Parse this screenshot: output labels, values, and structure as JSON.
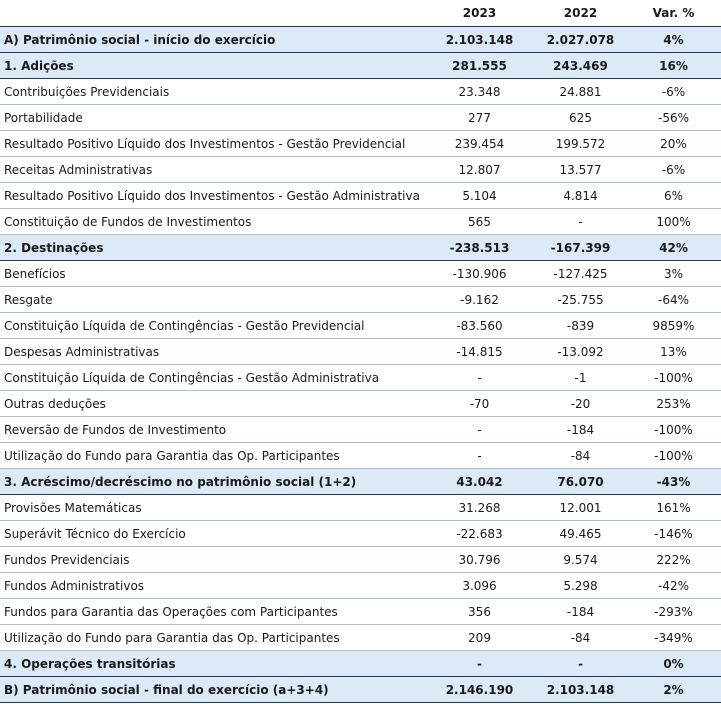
{
  "header": {
    "label": "",
    "y2023": "2023",
    "y2022": "2022",
    "var": "Var. %"
  },
  "rows": [
    {
      "label": "A) Patrimônio social - início do exercício",
      "y2023": "2.103.148",
      "y2022": "2.027.078",
      "var": "4%",
      "highlight": true
    },
    {
      "label": "1. Adições",
      "y2023": "281.555",
      "y2022": "243.469",
      "var": "16%",
      "highlight": true
    },
    {
      "label": "Contribuições Previdenciais",
      "y2023": "23.348",
      "y2022": "24.881",
      "var": "-6%",
      "highlight": false
    },
    {
      "label": "Portabilidade",
      "y2023": "277",
      "y2022": "625",
      "var": "-56%",
      "highlight": false
    },
    {
      "label": "Resultado Positivo Líquido dos Investimentos - Gestão Previdencial",
      "y2023": "239.454",
      "y2022": "199.572",
      "var": "20%",
      "highlight": false
    },
    {
      "label": "Receitas Administrativas",
      "y2023": "12.807",
      "y2022": "13.577",
      "var": "-6%",
      "highlight": false
    },
    {
      "label": "Resultado Positivo Líquido dos Investimentos - Gestão Administrativa",
      "y2023": "5.104",
      "y2022": "4.814",
      "var": "6%",
      "highlight": false
    },
    {
      "label": "Constituição de Fundos de Investimentos",
      "y2023": "565",
      "y2022": "-",
      "var": "100%",
      "highlight": false
    },
    {
      "label": "2. Destinações",
      "y2023": "-238.513",
      "y2022": "-167.399",
      "var": "42%",
      "highlight": true
    },
    {
      "label": "Benefícios",
      "y2023": "-130.906",
      "y2022": "-127.425",
      "var": "3%",
      "highlight": false
    },
    {
      "label": "Resgate",
      "y2023": "-9.162",
      "y2022": "-25.755",
      "var": "-64%",
      "highlight": false
    },
    {
      "label": "Constituição Líquida de Contingências - Gestão Previdencial",
      "y2023": "-83.560",
      "y2022": "-839",
      "var": "9859%",
      "highlight": false
    },
    {
      "label": "Despesas Administrativas",
      "y2023": "-14.815",
      "y2022": "-13.092",
      "var": "13%",
      "highlight": false
    },
    {
      "label": "Constituição Líquida de Contingências - Gestão Administrativa",
      "y2023": "-",
      "y2022": "-1",
      "var": "-100%",
      "highlight": false
    },
    {
      "label": "Outras deduções",
      "y2023": "-70",
      "y2022": "-20",
      "var": "253%",
      "highlight": false
    },
    {
      "label": "Reversão de Fundos de Investimento",
      "y2023": "-",
      "y2022": "-184",
      "var": "-100%",
      "highlight": false
    },
    {
      "label": "Utilização do Fundo para Garantia das Op. Participantes",
      "y2023": "-",
      "y2022": "-84",
      "var": "-100%",
      "highlight": false
    },
    {
      "label": "3. Acréscimo/decréscimo no patrimônio social (1+2)",
      "y2023": "43.042",
      "y2022": "76.070",
      "var": "-43%",
      "highlight": true
    },
    {
      "label": "Provisões Matemáticas",
      "y2023": "31.268",
      "y2022": "12.001",
      "var": "161%",
      "highlight": false
    },
    {
      "label": "Superávit Técnico do Exercício",
      "y2023": "-22.683",
      "y2022": "49.465",
      "var": "-146%",
      "highlight": false
    },
    {
      "label": "Fundos Previdenciais",
      "y2023": "30.796",
      "y2022": "9.574",
      "var": "222%",
      "highlight": false
    },
    {
      "label": "Fundos Administrativos",
      "y2023": "3.096",
      "y2022": "5.298",
      "var": "-42%",
      "highlight": false
    },
    {
      "label": "Fundos para Garantia das Operações com Participantes",
      "y2023": "356",
      "y2022": "-184",
      "var": "-293%",
      "highlight": false
    },
    {
      "label": "Utilização do Fundo para Garantia das Op. Participantes",
      "y2023": "209",
      "y2022": "-84",
      "var": "-349%",
      "highlight": false
    },
    {
      "label": "4. Operações transitórias",
      "y2023": "-",
      "y2022": "-",
      "var": "0%",
      "highlight": true
    },
    {
      "label": "B) Patrimônio social - final do exercício (a+3+4)",
      "y2023": "2.146.190",
      "y2022": "2.103.148",
      "var": "2%",
      "highlight": true
    }
  ]
}
